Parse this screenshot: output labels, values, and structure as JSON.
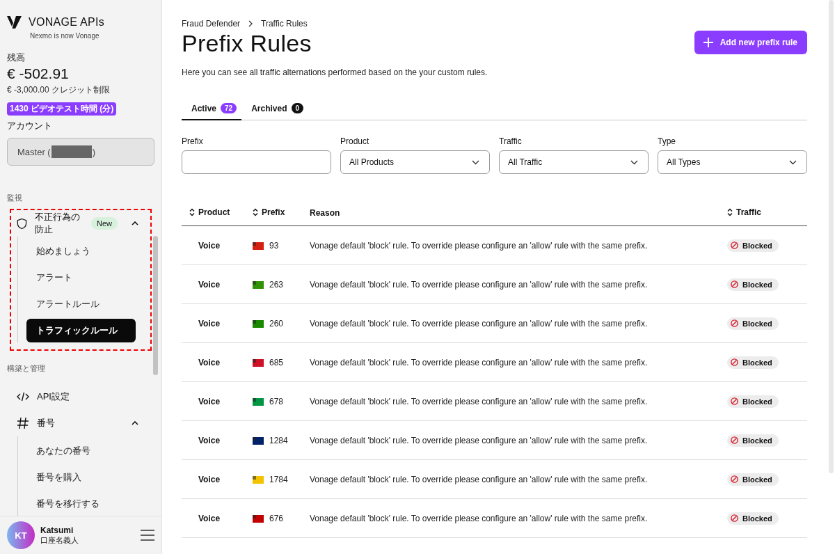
{
  "brand": {
    "name": "VONAGE APIs",
    "tagline": "Nexmo is now Vonage"
  },
  "balance": {
    "label": "残高",
    "amount": "€ -502.91",
    "credit": "€ -3,000.00 クレジット制限"
  },
  "promo_badge": "1430 ビデオテスト時間 (分)",
  "account": {
    "label": "アカウント",
    "value_prefix": "Master (",
    "value_suffix": ")"
  },
  "nav_sections": [
    {
      "title": "監視",
      "items": [
        {
          "label": "不正行為の防止",
          "kind": "shield",
          "badge": "New",
          "expanded": true,
          "highlighted": true,
          "children": [
            {
              "label": "始めましょう",
              "selected": false
            },
            {
              "label": "アラート",
              "selected": false
            },
            {
              "label": "アラートルール",
              "selected": false
            },
            {
              "label": "トラフィックルール",
              "selected": true
            }
          ]
        }
      ]
    },
    {
      "title": "構築と管理",
      "items": [
        {
          "label": "API設定",
          "kind": "code"
        },
        {
          "label": "番号",
          "kind": "hash",
          "expanded": true,
          "children": [
            {
              "label": "あなたの番号",
              "selected": false
            },
            {
              "label": "番号を購入",
              "selected": false
            },
            {
              "label": "番号を移行する",
              "selected": false
            }
          ]
        }
      ]
    }
  ],
  "user": {
    "initials": "KT",
    "name": "Katsumi",
    "role": "口座名義人"
  },
  "breadcrumb": [
    "Fraud Defender",
    "Traffic Rules"
  ],
  "page": {
    "title": "Prefix Rules",
    "description": "Here you can see all traffic alternations performed based on the your custom rules.",
    "add_button": "Add new prefix rule"
  },
  "tabs": [
    {
      "label": "Active",
      "count": "72",
      "selected": true
    },
    {
      "label": "Archived",
      "count": "0",
      "selected": false
    }
  ],
  "filters": [
    {
      "label": "Prefix",
      "kind": "text"
    },
    {
      "label": "Product",
      "kind": "select",
      "value": "All Products"
    },
    {
      "label": "Traffic",
      "kind": "select",
      "value": "All Traffic"
    },
    {
      "label": "Type",
      "kind": "select",
      "value": "All Types"
    }
  ],
  "table": {
    "columns": [
      {
        "label": "Product",
        "sortable": true
      },
      {
        "label": "Prefix",
        "sortable": true
      },
      {
        "label": "Reason",
        "sortable": false
      },
      {
        "label": "Traffic",
        "sortable": true
      }
    ],
    "rows": [
      {
        "product": "Voice",
        "prefix": "93",
        "color": "#d32011",
        "reason": "Vonage default 'block' rule. To override please configure an 'allow' rule with the same prefix.",
        "traffic": "Blocked"
      },
      {
        "product": "Voice",
        "prefix": "263",
        "color": "#319208",
        "reason": "Vonage default 'block' rule. To override please configure an 'allow' rule with the same prefix.",
        "traffic": "Blocked"
      },
      {
        "product": "Voice",
        "prefix": "260",
        "color": "#198a00",
        "reason": "Vonage default 'block' rule. To override please configure an 'allow' rule with the same prefix.",
        "traffic": "Blocked"
      },
      {
        "product": "Voice",
        "prefix": "685",
        "color": "#ce1126",
        "reason": "Vonage default 'block' rule. To override please configure an 'allow' rule with the same prefix.",
        "traffic": "Blocked"
      },
      {
        "product": "Voice",
        "prefix": "678",
        "color": "#009543",
        "reason": "Vonage default 'block' rule. To override please configure an 'allow' rule with the same prefix.",
        "traffic": "Blocked"
      },
      {
        "product": "Voice",
        "prefix": "1284",
        "color": "#012169",
        "reason": "Vonage default 'block' rule. To override please configure an 'allow' rule with the same prefix.",
        "traffic": "Blocked"
      },
      {
        "product": "Voice",
        "prefix": "1784",
        "color": "#f4c300",
        "reason": "Vonage default 'block' rule. To override please configure an 'allow' rule with the same prefix.",
        "traffic": "Blocked"
      },
      {
        "product": "Voice",
        "prefix": "676",
        "color": "#c10000",
        "reason": "Vonage default 'block' rule. To override please configure an 'allow' rule with the same prefix.",
        "traffic": "Blocked"
      }
    ]
  }
}
